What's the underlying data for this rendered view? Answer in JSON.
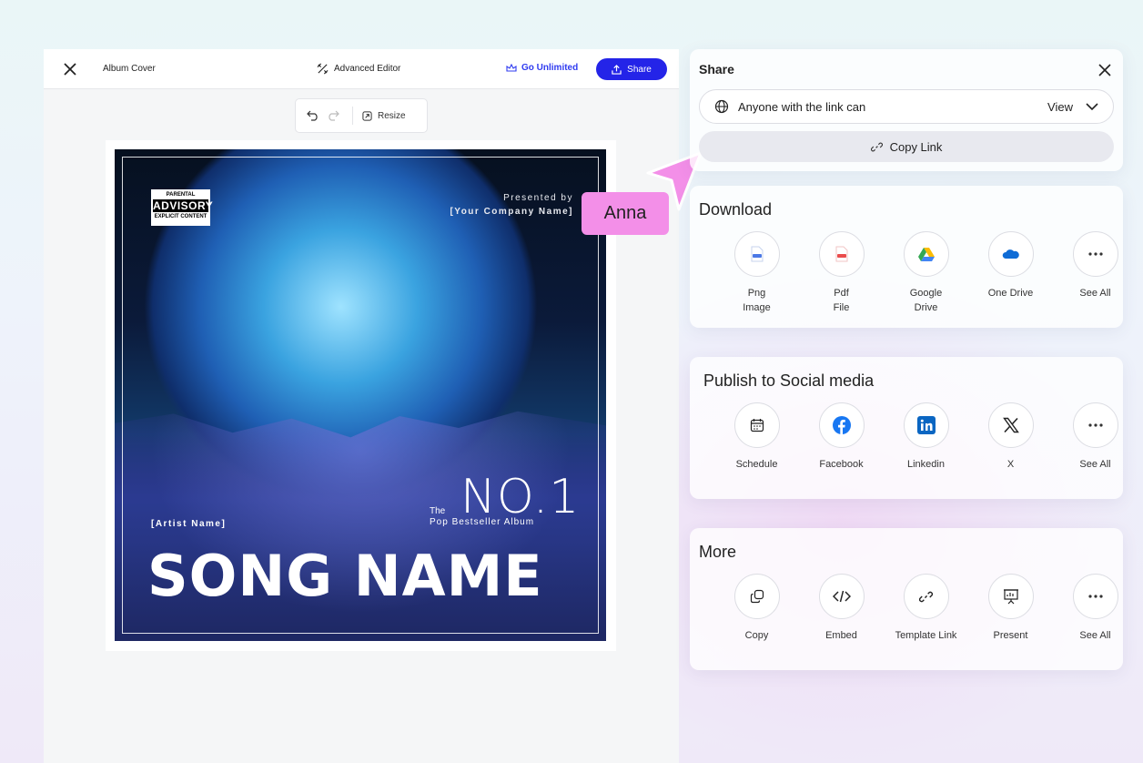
{
  "editor": {
    "doc_title": "Album Cover",
    "advanced_editor": "Advanced Editor",
    "go_unlimited": "Go Unlimited",
    "share": "Share",
    "resize": "Resize"
  },
  "cover": {
    "advisory_top": "PARENTAL",
    "advisory_mid": "ADVISORY",
    "advisory_bot": "EXPLICIT CONTENT",
    "presented_by": "Presented by",
    "company": "[Your Company Name]",
    "artist": "[Artist Name]",
    "the": "The",
    "number": "NO.1",
    "subtitle": "Pop Bestseller Album",
    "song": "SONG NAME"
  },
  "collaborator": {
    "name": "Anna",
    "color": "#f38fe8"
  },
  "share_panel": {
    "title": "Share",
    "permission_text": "Anyone with the link can",
    "permission_value": "View",
    "copy_link": "Copy Link"
  },
  "download": {
    "title": "Download",
    "items": [
      {
        "label": "Png\nImage",
        "icon": "png-file-icon"
      },
      {
        "label": "Pdf\nFile",
        "icon": "pdf-file-icon"
      },
      {
        "label": "Google\nDrive",
        "icon": "google-drive-icon"
      },
      {
        "label": "One Drive",
        "icon": "onedrive-icon"
      },
      {
        "label": "See All",
        "icon": "more-icon"
      }
    ]
  },
  "social": {
    "title": "Publish to Social media",
    "items": [
      {
        "label": "Schedule",
        "icon": "calendar-icon"
      },
      {
        "label": "Facebook",
        "icon": "facebook-icon"
      },
      {
        "label": "Linkedin",
        "icon": "linkedin-icon"
      },
      {
        "label": "X",
        "icon": "x-icon"
      },
      {
        "label": "See All",
        "icon": "more-icon"
      }
    ]
  },
  "more": {
    "title": "More",
    "items": [
      {
        "label": "Copy",
        "icon": "copy-icon"
      },
      {
        "label": "Embed",
        "icon": "embed-icon"
      },
      {
        "label": "Template Link",
        "icon": "link-icon"
      },
      {
        "label": "Present",
        "icon": "present-icon"
      },
      {
        "label": "See All",
        "icon": "more-icon"
      }
    ]
  },
  "colors": {
    "accent": "#2424e8",
    "collaborator": "#f38fe8"
  }
}
